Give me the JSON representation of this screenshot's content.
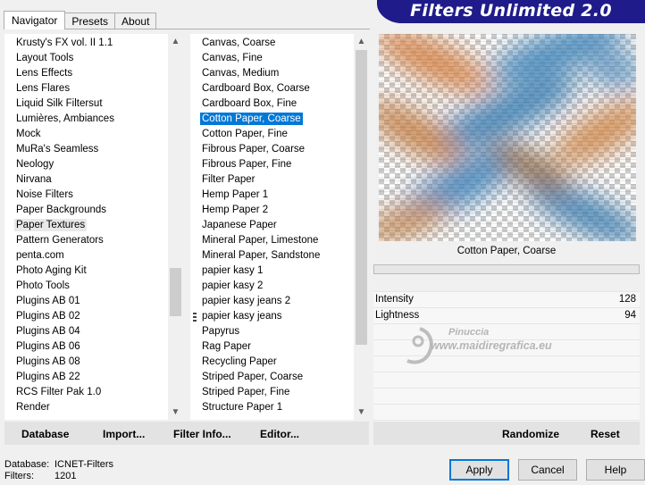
{
  "tabs": [
    "Navigator",
    "Presets",
    "About"
  ],
  "banner": "Filters Unlimited 2.0",
  "categories": [
    "Krusty's FX vol. II 1.1",
    "Layout Tools",
    "Lens Effects",
    "Lens Flares",
    "Liquid Silk Filtersut",
    "Lumières, Ambiances",
    "Mock",
    "MuRa's Seamless",
    "Neology",
    "Nirvana",
    "Noise Filters",
    "Paper Backgrounds",
    "Paper Textures",
    "Pattern Generators",
    "penta.com",
    "Photo Aging Kit",
    "Photo Tools",
    "Plugins AB 01",
    "Plugins AB 02",
    "Plugins AB 04",
    "Plugins AB 06",
    "Plugins AB 08",
    "Plugins AB 22",
    "RCS Filter Pak 1.0",
    "Render"
  ],
  "selected_category": "Paper Textures",
  "filters": [
    "Canvas, Coarse",
    "Canvas, Fine",
    "Canvas, Medium",
    "Cardboard Box, Coarse",
    "Cardboard Box, Fine",
    "Cotton Paper, Coarse",
    "Cotton Paper, Fine",
    "Fibrous Paper, Coarse",
    "Fibrous Paper, Fine",
    "Filter Paper",
    "Hemp Paper 1",
    "Hemp Paper 2",
    "Japanese Paper",
    "Mineral Paper, Limestone",
    "Mineral Paper, Sandstone",
    "papier kasy 1",
    "papier kasy 2",
    "papier kasy jeans 2",
    "papier kasy jeans",
    "Papyrus",
    "Rag Paper",
    "Recycling Paper",
    "Striped Paper, Coarse",
    "Striped Paper, Fine",
    "Structure Paper 1"
  ],
  "selected_filter": "Cotton Paper, Coarse",
  "marked_filter": "papier kasy jeans",
  "toolbar_left": {
    "database": "Database",
    "import": "Import...",
    "filter_info": "Filter Info...",
    "editor": "Editor..."
  },
  "filter_name": "Cotton Paper, Coarse",
  "params": [
    {
      "label": "Intensity",
      "value": "128"
    },
    {
      "label": "Lightness",
      "value": "94"
    }
  ],
  "watermark": {
    "line1": "Pinuccia",
    "line2": "www.maidiregrafica.eu"
  },
  "toolbar_right": {
    "randomize": "Randomize",
    "reset": "Reset"
  },
  "status": {
    "db_label": "Database:",
    "db_value": "ICNET-Filters",
    "filters_label": "Filters:",
    "filters_value": "1201"
  },
  "buttons": {
    "apply": "Apply",
    "cancel": "Cancel",
    "help": "Help"
  },
  "colors": {
    "selection": "#0078d7",
    "banner": "#1f1b8a"
  }
}
